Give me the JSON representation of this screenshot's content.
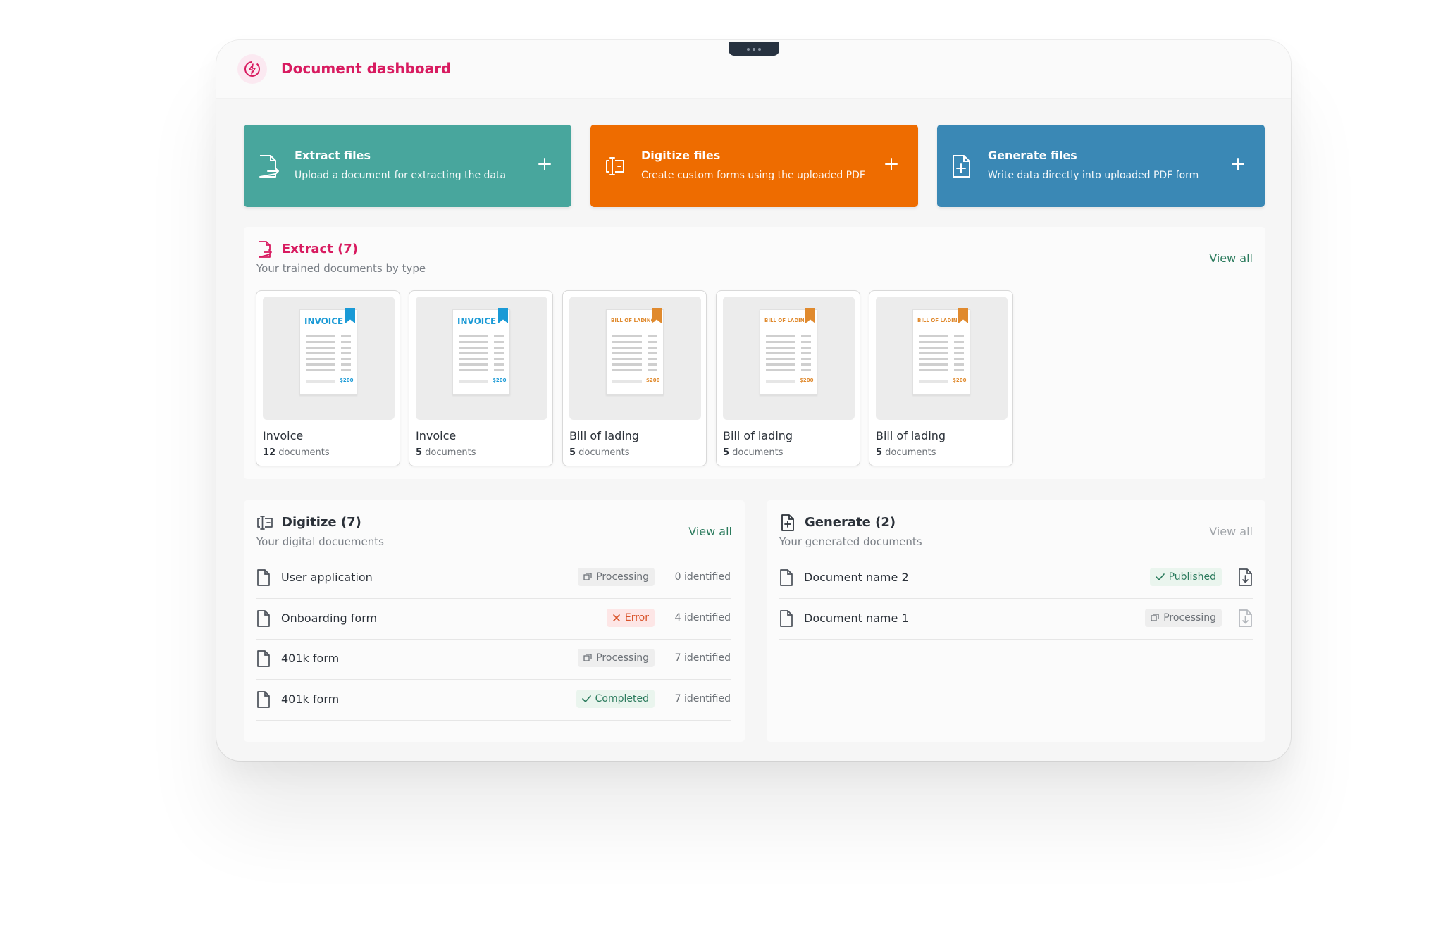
{
  "app": {
    "title": "Document dashboard"
  },
  "actions": [
    {
      "title": "Extract files",
      "subtitle": "Upload a document for extracting the data",
      "color": "#48a69d"
    },
    {
      "title": "Digitize files",
      "subtitle": "Create custom forms using the uploaded PDF",
      "color": "#ee6c00"
    },
    {
      "title": "Generate files",
      "subtitle": "Write data directly into uploaded PDF form",
      "color": "#3a88b5"
    }
  ],
  "extract": {
    "title": "Extract (7)",
    "subtitle": "Your trained documents by type",
    "view_all": "View all",
    "docs": [
      {
        "name": "Invoice",
        "count": "12",
        "count_suffix": " documents",
        "header": "INVOICE",
        "amount": "$200",
        "accent": "#1a9ad6"
      },
      {
        "name": "Invoice",
        "count": "5",
        "count_suffix": " documents",
        "header": "INVOICE",
        "amount": "$200",
        "accent": "#1a9ad6"
      },
      {
        "name": "Bill of lading",
        "count": "5",
        "count_suffix": " documents",
        "header": "BILL OF LADING",
        "amount": "$200",
        "accent": "#e08a2e"
      },
      {
        "name": "Bill of lading",
        "count": "5",
        "count_suffix": " documents",
        "header": "BILL OF LADING",
        "amount": "$200",
        "accent": "#e08a2e"
      },
      {
        "name": "Bill of lading",
        "count": "5",
        "count_suffix": " documents",
        "header": "BILL OF LADING",
        "amount": "$200",
        "accent": "#e08a2e"
      }
    ]
  },
  "digitize": {
    "title": "Digitize (7)",
    "subtitle": "Your digital docuements",
    "view_all": "View all",
    "rows": [
      {
        "name": "User application",
        "status": "Processing",
        "identified": "0 identified"
      },
      {
        "name": "Onboarding form",
        "status": "Error",
        "identified": "4 identified"
      },
      {
        "name": "401k form",
        "status": "Processing",
        "identified": "7 identified"
      },
      {
        "name": "401k form",
        "status": "Completed",
        "identified": "7 identified"
      }
    ]
  },
  "generate": {
    "title": "Generate (2)",
    "subtitle": "Your generated documents",
    "view_all": "View all",
    "rows": [
      {
        "name": "Document name 2",
        "status": "Published"
      },
      {
        "name": "Document name 1",
        "status": "Processing"
      }
    ]
  }
}
